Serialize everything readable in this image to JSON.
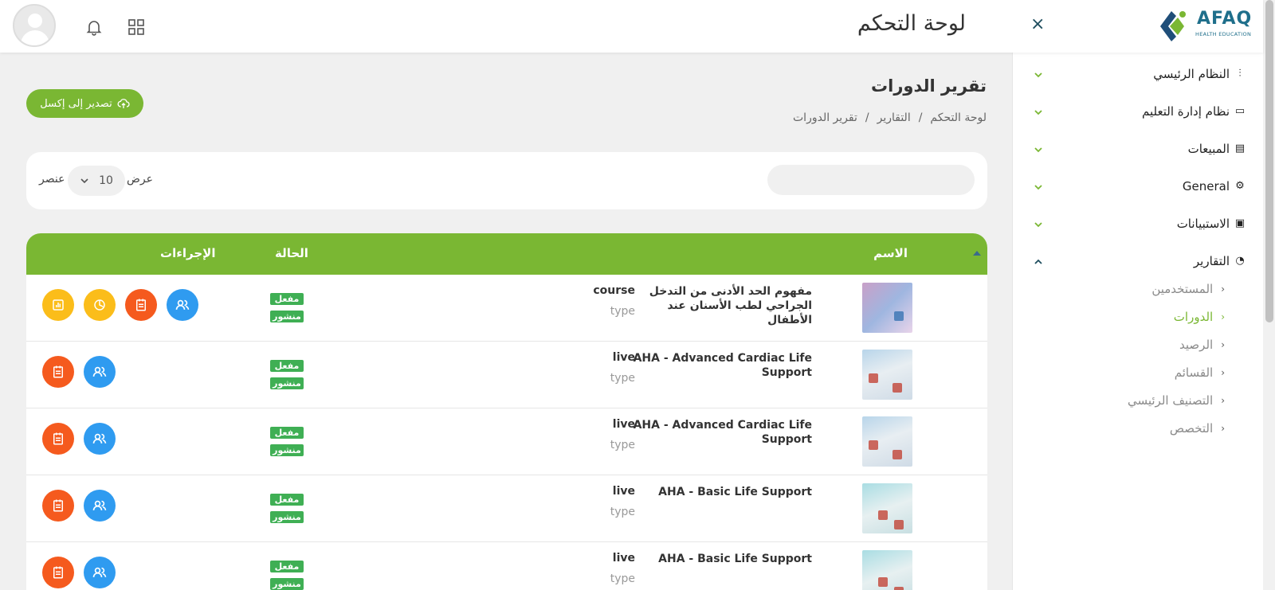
{
  "header": {
    "page_title": "لوحة التحكم",
    "close": "×",
    "logo_text": "AFAQ",
    "logo_sub": "HEALTH EDUCATION"
  },
  "sidebar": {
    "items": [
      {
        "label": "النظام الرئيسي",
        "icon": "sliders-icon"
      },
      {
        "label": "نظام إدارة التعليم",
        "icon": "book-icon"
      },
      {
        "label": "المبيعات",
        "icon": "receipt-icon"
      },
      {
        "label": "General",
        "icon": "gear-icon"
      },
      {
        "label": "الاستبيانات",
        "icon": "clipboard-icon"
      },
      {
        "label": "التقارير",
        "icon": "pie-chart-icon"
      }
    ],
    "report_subitems": [
      "المستخدمين",
      "الدورات",
      "الرصيد",
      "القسائم",
      "التصنيف الرئيسي",
      "التخصص"
    ],
    "active_subitem": "الدورات"
  },
  "main": {
    "title": "تقرير الدورات",
    "breadcrumb": [
      "لوحة التحكم",
      "/",
      "التقارير",
      "/",
      "تقرير الدورات"
    ],
    "export_label": "تصدير إلى إكسل",
    "show_label": "عرض",
    "page_size": "10",
    "items_label": "عنصر",
    "search_placeholder": ""
  },
  "table": {
    "headers": {
      "name": "الاسم",
      "status": "الحالة",
      "actions": "الإجراءات"
    },
    "type_label": "type",
    "rows": [
      {
        "name": "مفهوم الحد الأدنى من التدخل الجراحي لطب الأسنان عند الأطفال",
        "type": "course",
        "badges": [
          "مفعل",
          "منشور"
        ],
        "actions": [
          "users",
          "report",
          "clock-chart",
          "bar-chart"
        ]
      },
      {
        "name": "AHA - Advanced Cardiac Life Support",
        "type": "live",
        "badges": [
          "مفعل",
          "منشور"
        ],
        "actions": [
          "users",
          "report"
        ]
      },
      {
        "name": "AHA - Advanced Cardiac Life Support",
        "type": "live",
        "badges": [
          "مفعل",
          "منشور"
        ],
        "actions": [
          "users",
          "report"
        ]
      },
      {
        "name": "AHA - Basic Life Support",
        "type": "live",
        "badges": [
          "مفعل",
          "منشور"
        ],
        "actions": [
          "users",
          "report"
        ]
      },
      {
        "name": "AHA - Basic Life Support",
        "type": "live",
        "badges": [
          "مفعل",
          "منشور"
        ],
        "actions": [
          "users",
          "report"
        ]
      }
    ]
  },
  "colors": {
    "accent_green": "#7ab733",
    "badge_green": "#3faf54",
    "action_blue": "#2f9bf0",
    "action_orange": "#f55a1e",
    "action_yellow": "#fbbd1a"
  }
}
